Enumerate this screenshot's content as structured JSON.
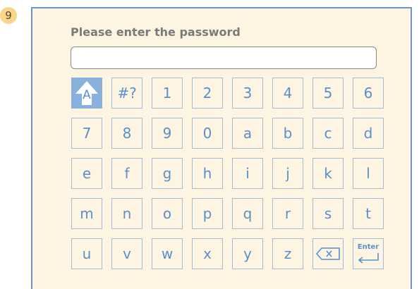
{
  "step_number": "9",
  "prompt_label": "Please enter the password",
  "password_value": "",
  "keyboard": {
    "rows": [
      [
        {
          "label": "A",
          "name": "shift-key",
          "icon": "shift-arrow-icon"
        },
        {
          "label": "#?",
          "name": "symbols-key"
        },
        {
          "label": "1"
        },
        {
          "label": "2"
        },
        {
          "label": "3"
        },
        {
          "label": "4"
        },
        {
          "label": "5"
        },
        {
          "label": "6"
        }
      ],
      [
        {
          "label": "7"
        },
        {
          "label": "8"
        },
        {
          "label": "9"
        },
        {
          "label": "0"
        },
        {
          "label": "a"
        },
        {
          "label": "b"
        },
        {
          "label": "c"
        },
        {
          "label": "d"
        }
      ],
      [
        {
          "label": "e"
        },
        {
          "label": "f"
        },
        {
          "label": "g"
        },
        {
          "label": "h"
        },
        {
          "label": "i"
        },
        {
          "label": "j"
        },
        {
          "label": "k"
        },
        {
          "label": "l"
        }
      ],
      [
        {
          "label": "m"
        },
        {
          "label": "n"
        },
        {
          "label": "o"
        },
        {
          "label": "p"
        },
        {
          "label": "q"
        },
        {
          "label": "r"
        },
        {
          "label": "s"
        },
        {
          "label": "t"
        }
      ],
      [
        {
          "label": "u"
        },
        {
          "label": "v"
        },
        {
          "label": "w"
        },
        {
          "label": "x"
        },
        {
          "label": "y"
        },
        {
          "label": "z"
        },
        {
          "label": "",
          "name": "backspace-key",
          "icon": "backspace-icon"
        },
        {
          "label": "Enter",
          "name": "enter-key",
          "icon": "enter-return-icon"
        }
      ]
    ]
  },
  "colors": {
    "panel_bg": "#fdf5e2",
    "panel_border": "#6b96c8",
    "key_border": "#a5bad6",
    "key_text": "#5a8fcf",
    "active_key_bg": "#8ab1dc",
    "badge_bg": "#fbd58a"
  }
}
